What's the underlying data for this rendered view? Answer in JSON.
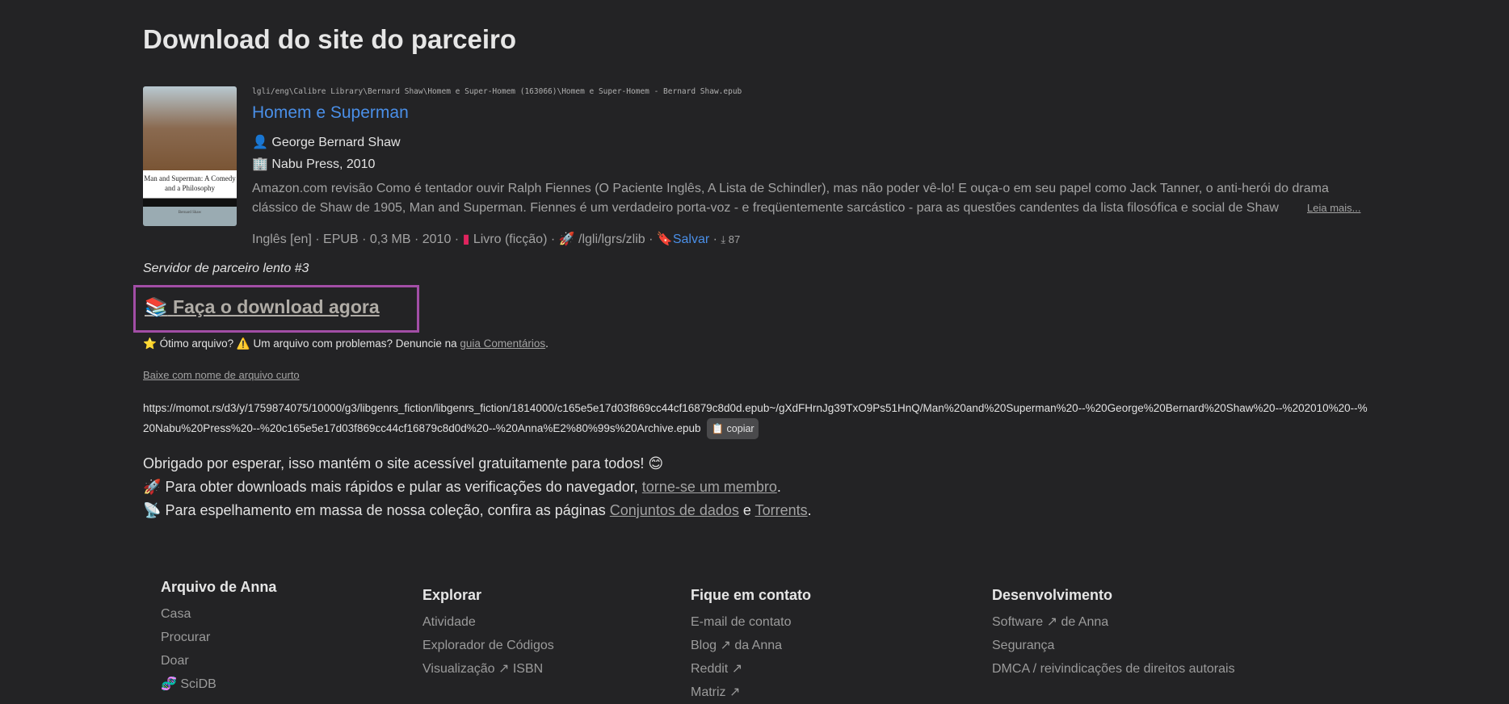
{
  "page_title": "Download do site do parceiro",
  "book": {
    "path": "lgli/eng\\Calibre Library\\Bernard Shaw\\Homem e Super-Homem (163066)\\Homem e Super-Homem - Bernard Shaw.epub",
    "title": "Homem e Superman",
    "cover_title": "Man and Superman: A Comedy and a Philosophy",
    "cover_author": "Bernard Shaw",
    "author": "George Bernard Shaw",
    "publisher": "Nabu Press, 2010",
    "description_line1": "Amazon.com revisão Como é tentador ouvir Ralph Fiennes (O Paciente Inglês, A Lista de Schindler), mas não poder vê-lo! E ouça-o em seu papel como Jack Tanner, o anti-herói do drama",
    "description_line2": "clássico de Shaw de 1905, Man and Superman. Fiennes é um verdadeiro porta-voz - e freqüentemente sarcástico - para as questões candentes da lista filosófica e social de Shaw",
    "read_more": "Leia mais...",
    "language": "Inglês [en]",
    "format": "EPUB",
    "size": "0,3 MB",
    "year": "2010",
    "category": "Livro (ficção)",
    "sources": "/lgli/lgrs/zlib",
    "save": "Salvar",
    "downloads": "87"
  },
  "server_label": "Servidor de parceiro lento #3",
  "download_now": "Faça o download agora",
  "rating": {
    "good": "Ótimo arquivo?",
    "bad": "Um arquivo com problemas? Denuncie na",
    "link": "guia Comentários"
  },
  "short_filename": "Baixe com nome de arquivo curto",
  "download_url": "https://momot.rs/d3/y/1759874075/10000/g3/libgenrs_fiction/libgenrs_fiction/1814000/c165e5e17d03f869cc44cf16879c8d0d.epub~/gXdFHrnJg39TxO9Ps51HnQ/Man%20and%20Superman%20--%20George%20Bernard%20Shaw%20--%202010%20--%20Nabu%20Press%20--%20c165e5e17d03f869cc44cf16879c8d0d%20--%20Anna%E2%80%99s%20Archive.epub",
  "copy": "copiar",
  "thanks": {
    "line1": "Obrigado por esperar, isso mantém o site acessível gratuitamente para todos!",
    "line2": "Para obter downloads mais rápidos e pular as verificações do navegador,",
    "line2_link": "torne-se um membro",
    "line3": "Para espelhamento em massa de nossa coleção, confira as páginas",
    "line3_link1": "Conjuntos de dados",
    "line3_and": "e",
    "line3_link2": "Torrents"
  },
  "footer": {
    "col1": {
      "heading": "Arquivo de Anna",
      "items": [
        "Casa",
        "Procurar",
        "Doar",
        "SciDB"
      ]
    },
    "col2": {
      "heading": "Explorar",
      "items": [
        "Atividade",
        "Explorador de Códigos",
        "Visualização ↗ ISBN"
      ]
    },
    "col3": {
      "heading": "Fique em contato",
      "items": [
        "E-mail de contato",
        "Blog ↗ da Anna",
        "Reddit ↗",
        "Matriz ↗"
      ]
    },
    "col4": {
      "heading": "Desenvolvimento",
      "items": [
        "Software ↗ de Anna",
        "Segurança",
        "DMCA / reivindicações de direitos autorais"
      ]
    }
  }
}
